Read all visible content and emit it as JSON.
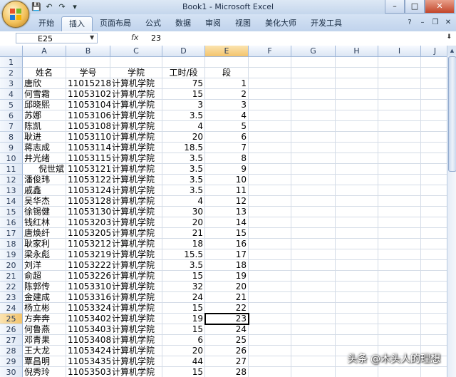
{
  "app": {
    "window_title": "Book1 - Microsoft Excel",
    "watermark": "头条 @木头人的理想"
  },
  "qat": {
    "save": "save-icon",
    "undo": "undo-icon",
    "redo": "redo-icon"
  },
  "ribbon": {
    "tabs": [
      {
        "label": "开始",
        "active": false
      },
      {
        "label": "插入",
        "active": true
      },
      {
        "label": "页面布局",
        "active": false
      },
      {
        "label": "公式",
        "active": false
      },
      {
        "label": "数据",
        "active": false
      },
      {
        "label": "审阅",
        "active": false
      },
      {
        "label": "视图",
        "active": false
      },
      {
        "label": "美化大师",
        "active": false
      },
      {
        "label": "开发工具",
        "active": false
      }
    ]
  },
  "formula_bar": {
    "name_box": "E25",
    "formula": "23",
    "fx": "fx"
  },
  "columns": [
    "A",
    "B",
    "C",
    "D",
    "E",
    "F",
    "G",
    "H",
    "I",
    "J"
  ],
  "selected_column": "E",
  "selected_row": 25,
  "header_row": {
    "row": 2,
    "A": "姓名",
    "B": "学号",
    "C": "学院",
    "D": "工时/段",
    "E": "段"
  },
  "rows": [
    {
      "n": 3,
      "name": "唐欣",
      "id": "11015218",
      "college": "计算机学院",
      "hours": "75",
      "seg": "1"
    },
    {
      "n": 4,
      "name": "何雪霜",
      "id": "11053102",
      "college": "计算机学院",
      "hours": "15",
      "seg": "2"
    },
    {
      "n": 5,
      "name": "邱晓熙",
      "id": "11053104",
      "college": "计算机学院",
      "hours": "3",
      "seg": "3"
    },
    {
      "n": 6,
      "name": "苏娜",
      "id": "11053106",
      "college": "计算机学院",
      "hours": "3.5",
      "seg": "4"
    },
    {
      "n": 7,
      "name": "陈凯",
      "id": "11053108",
      "college": "计算机学院",
      "hours": "4",
      "seg": "5"
    },
    {
      "n": 8,
      "name": "耿进",
      "id": "11053110",
      "college": "计算机学院",
      "hours": "20",
      "seg": "6"
    },
    {
      "n": 9,
      "name": "蒋志成",
      "id": "11053114",
      "college": "计算机学院",
      "hours": "18.5",
      "seg": "7"
    },
    {
      "n": 10,
      "name": "井光绪",
      "id": "11053115",
      "college": "计算机学院",
      "hours": "3.5",
      "seg": "8"
    },
    {
      "n": 11,
      "name": "倪世斌",
      "id": "11053121",
      "college": "计算机学院",
      "hours": "3.5",
      "seg": "9"
    },
    {
      "n": 12,
      "name": "潘俊玮",
      "id": "11053122",
      "college": "计算机学院",
      "hours": "3.5",
      "seg": "10"
    },
    {
      "n": 13,
      "name": "戚鑫",
      "id": "11053124",
      "college": "计算机学院",
      "hours": "3.5",
      "seg": "11"
    },
    {
      "n": 14,
      "name": "吴华杰",
      "id": "11053128",
      "college": "计算机学院",
      "hours": "4",
      "seg": "12"
    },
    {
      "n": 15,
      "name": "徐锡健",
      "id": "11053130",
      "college": "计算机学院",
      "hours": "30",
      "seg": "13"
    },
    {
      "n": 16,
      "name": "钱红林",
      "id": "11053203",
      "college": "计算机学院",
      "hours": "20",
      "seg": "14"
    },
    {
      "n": 17,
      "name": "唐焕纤",
      "id": "11053205",
      "college": "计算机学院",
      "hours": "21",
      "seg": "15"
    },
    {
      "n": 18,
      "name": "耿家利",
      "id": "11053212",
      "college": "计算机学院",
      "hours": "18",
      "seg": "16"
    },
    {
      "n": 19,
      "name": "梁永彪",
      "id": "11053219",
      "college": "计算机学院",
      "hours": "15.5",
      "seg": "17"
    },
    {
      "n": 20,
      "name": "刘洋",
      "id": "11053222",
      "college": "计算机学院",
      "hours": "3.5",
      "seg": "18"
    },
    {
      "n": 21,
      "name": "俞超",
      "id": "11053226",
      "college": "计算机学院",
      "hours": "15",
      "seg": "19"
    },
    {
      "n": 22,
      "name": "陈郭传",
      "id": "11053310",
      "college": "计算机学院",
      "hours": "32",
      "seg": "20"
    },
    {
      "n": 23,
      "name": "金建成",
      "id": "11053316",
      "college": "计算机学院",
      "hours": "24",
      "seg": "21"
    },
    {
      "n": 24,
      "name": "杨立彬",
      "id": "11053324",
      "college": "计算机学院",
      "hours": "15",
      "seg": "22"
    },
    {
      "n": 25,
      "name": "方奔奔",
      "id": "11053402",
      "college": "计算机学院",
      "hours": "19",
      "seg": "23"
    },
    {
      "n": 26,
      "name": "何鲁燕",
      "id": "11053403",
      "college": "计算机学院",
      "hours": "15",
      "seg": "24"
    },
    {
      "n": 27,
      "name": "邓青果",
      "id": "11053408",
      "college": "计算机学院",
      "hours": "6",
      "seg": "25"
    },
    {
      "n": 28,
      "name": "王大龙",
      "id": "11053424",
      "college": "计算机学院",
      "hours": "20",
      "seg": "26"
    },
    {
      "n": 29,
      "name": "覃昌明",
      "id": "11053435",
      "college": "计算机学院",
      "hours": "44",
      "seg": "27"
    },
    {
      "n": 30,
      "name": "倪秀玲",
      "id": "11053503",
      "college": "计算机学院",
      "hours": "15",
      "seg": "28"
    }
  ]
}
